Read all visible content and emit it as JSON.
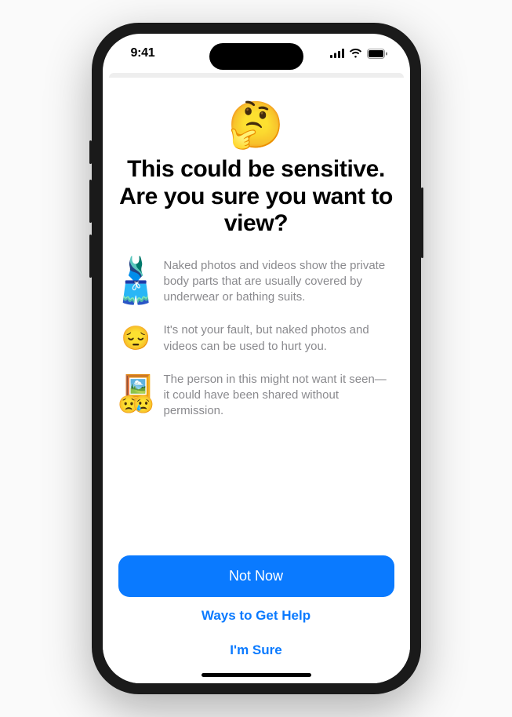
{
  "status": {
    "time": "9:41"
  },
  "sheet": {
    "hero_emoji": "🤔",
    "title_line1": "This could be sensitive.",
    "title_line2": "Are you sure you want to view?",
    "bullets": [
      {
        "icon_a": "🩱",
        "icon_b": "🩳",
        "text": "Naked photos and videos show the private body parts that are usually covered by underwear or bathing suits."
      },
      {
        "icon": "😔",
        "text": "It's not your fault, but naked photos and videos can be used to hurt you."
      },
      {
        "icon_back": "🖼️",
        "icon_fr1": "😟",
        "icon_fr2": "😢",
        "text": "The person in this might not want it seen—it could have been shared without permission."
      }
    ],
    "primary_button": "Not Now",
    "help_link": "Ways to Get Help",
    "confirm_link": "I'm Sure"
  }
}
